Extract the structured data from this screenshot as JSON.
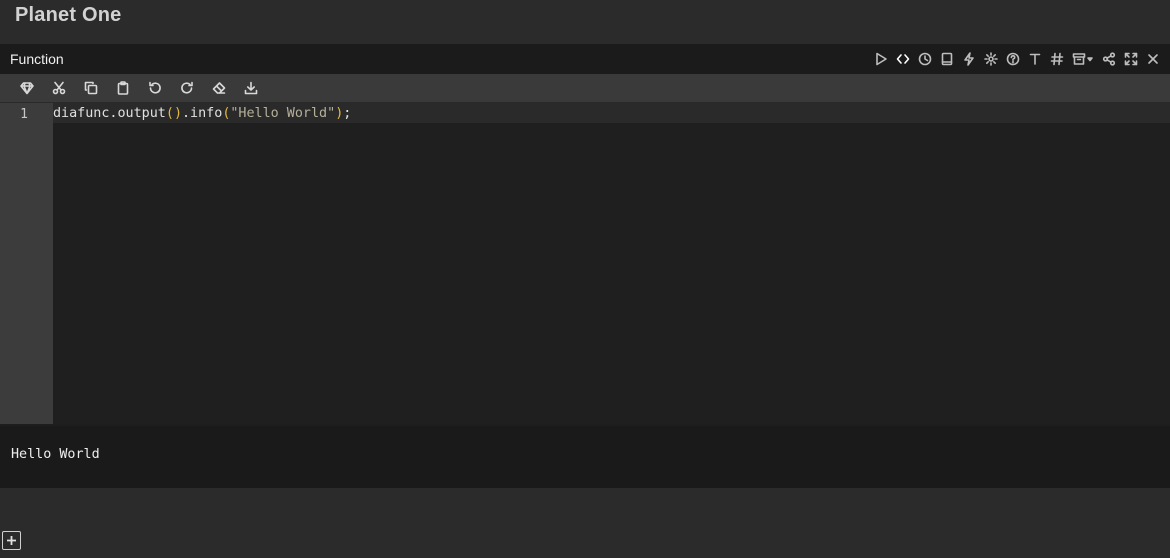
{
  "page": {
    "title": "Planet One"
  },
  "panel": {
    "title": "Function",
    "header_tools": [
      {
        "name": "run-icon"
      },
      {
        "name": "code-icon"
      },
      {
        "name": "history-icon"
      },
      {
        "name": "book-icon"
      },
      {
        "name": "lightning-icon"
      },
      {
        "name": "gear-icon"
      },
      {
        "name": "help-icon"
      },
      {
        "name": "text-icon"
      },
      {
        "name": "hash-icon"
      },
      {
        "name": "archive-dropdown-icon"
      },
      {
        "name": "share-icon"
      },
      {
        "name": "expand-icon"
      },
      {
        "name": "close-icon"
      }
    ],
    "editor_tools": [
      {
        "name": "gem-icon"
      },
      {
        "name": "cut-icon"
      },
      {
        "name": "copy-icon"
      },
      {
        "name": "paste-icon"
      },
      {
        "name": "undo-icon"
      },
      {
        "name": "redo-icon"
      },
      {
        "name": "eraser-icon"
      },
      {
        "name": "download-icon"
      }
    ]
  },
  "editor": {
    "line_number": "1",
    "code": {
      "ident": "diafunc.output",
      "paren_open": "(",
      "paren_close": ")",
      "method": ".info",
      "arg_open": "(",
      "string": "\"Hello World\"",
      "arg_close": ")",
      "semicolon": ";"
    }
  },
  "output": {
    "text": "Hello World"
  },
  "colors": {
    "background": "#2b2b2b",
    "gutter": "#3c3c3c",
    "paren": "#e5b93f",
    "string": "#b5b09a"
  }
}
